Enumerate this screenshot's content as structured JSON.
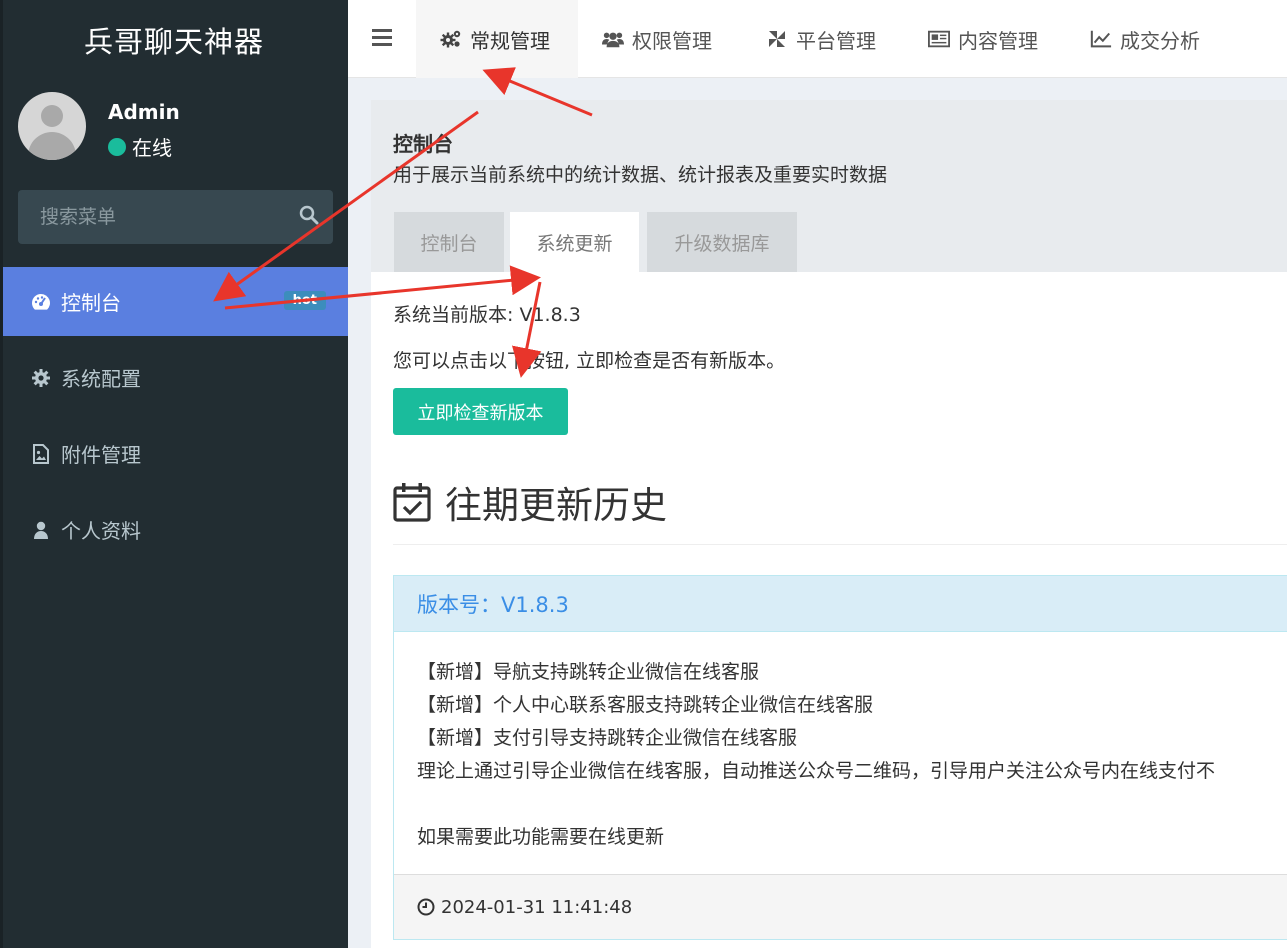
{
  "app": {
    "title": "兵哥聊天神器"
  },
  "user": {
    "name": "Admin",
    "status": "在线"
  },
  "search": {
    "placeholder": "搜索菜单"
  },
  "sidebar": {
    "items": [
      {
        "label": "控制台",
        "icon": "dashboard-icon",
        "badge": "hot",
        "active": true
      },
      {
        "label": "系统配置",
        "icon": "gear-icon"
      },
      {
        "label": "附件管理",
        "icon": "image-file-icon"
      },
      {
        "label": "个人资料",
        "icon": "user-icon"
      }
    ]
  },
  "topnav": {
    "tabs": [
      {
        "label": "常规管理",
        "icon": "cogs-icon",
        "active": true
      },
      {
        "label": "权限管理",
        "icon": "users-icon"
      },
      {
        "label": "平台管理",
        "icon": "pinwheel-icon"
      },
      {
        "label": "内容管理",
        "icon": "newspaper-icon"
      },
      {
        "label": "成交分析",
        "icon": "line-chart-icon"
      }
    ]
  },
  "page": {
    "title": "控制台",
    "description": "用于展示当前系统中的统计数据、统计报表及重要实时数据",
    "tabs": [
      {
        "label": "控制台"
      },
      {
        "label": "系统更新",
        "active": true
      },
      {
        "label": "升级数据库"
      }
    ]
  },
  "update": {
    "version_text": "系统当前版本: V1.8.3",
    "hint": "您可以点击以下按钮, 立即检查是否有新版本。",
    "check_button": "立即检查新版本",
    "history_title": "往期更新历史"
  },
  "release": {
    "version_label": "版本号：V1.8.3",
    "lines": [
      "【新增】导航支持跳转企业微信在线客服",
      "【新增】个人中心联系客服支持跳转企业微信在线客服",
      "【新增】支付引导支持跳转企业微信在线客服",
      "理论上通过引导企业微信在线客服，自动推送公众号二维码，引导用户关注公众号内在线支付不",
      "",
      "如果需要此功能需要在线更新"
    ],
    "timestamp": "2024-01-31 11:41:48"
  },
  "colors": {
    "sidebar_bg": "#222d32",
    "active_item": "#5a7fe0",
    "button": "#1abc9c",
    "annotation_arrow": "#e8352b"
  }
}
